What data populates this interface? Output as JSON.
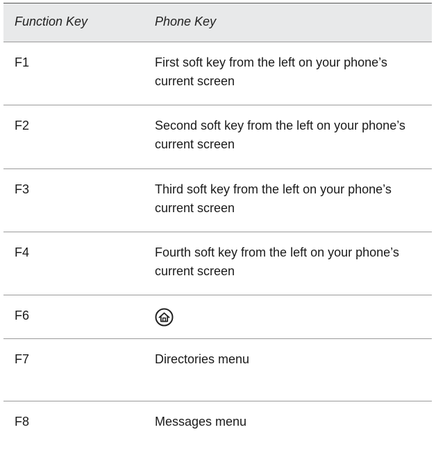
{
  "table": {
    "headers": [
      "Function Key",
      "Phone Key"
    ],
    "rows": [
      {
        "key": "F1",
        "value": "First soft key from the left on your phone’s current screen"
      },
      {
        "key": "F2",
        "value": "Second soft key from the left on your phone’s current screen"
      },
      {
        "key": "F3",
        "value": "Third soft key from the left on your phone’s current screen"
      },
      {
        "key": "F4",
        "value": "Fourth soft key from the left on your phone’s current screen"
      },
      {
        "key": "F6",
        "value": "",
        "icon": "home-icon"
      },
      {
        "key": "F7",
        "value": "Directories menu"
      },
      {
        "key": "F8",
        "value": "Messages menu"
      }
    ]
  }
}
